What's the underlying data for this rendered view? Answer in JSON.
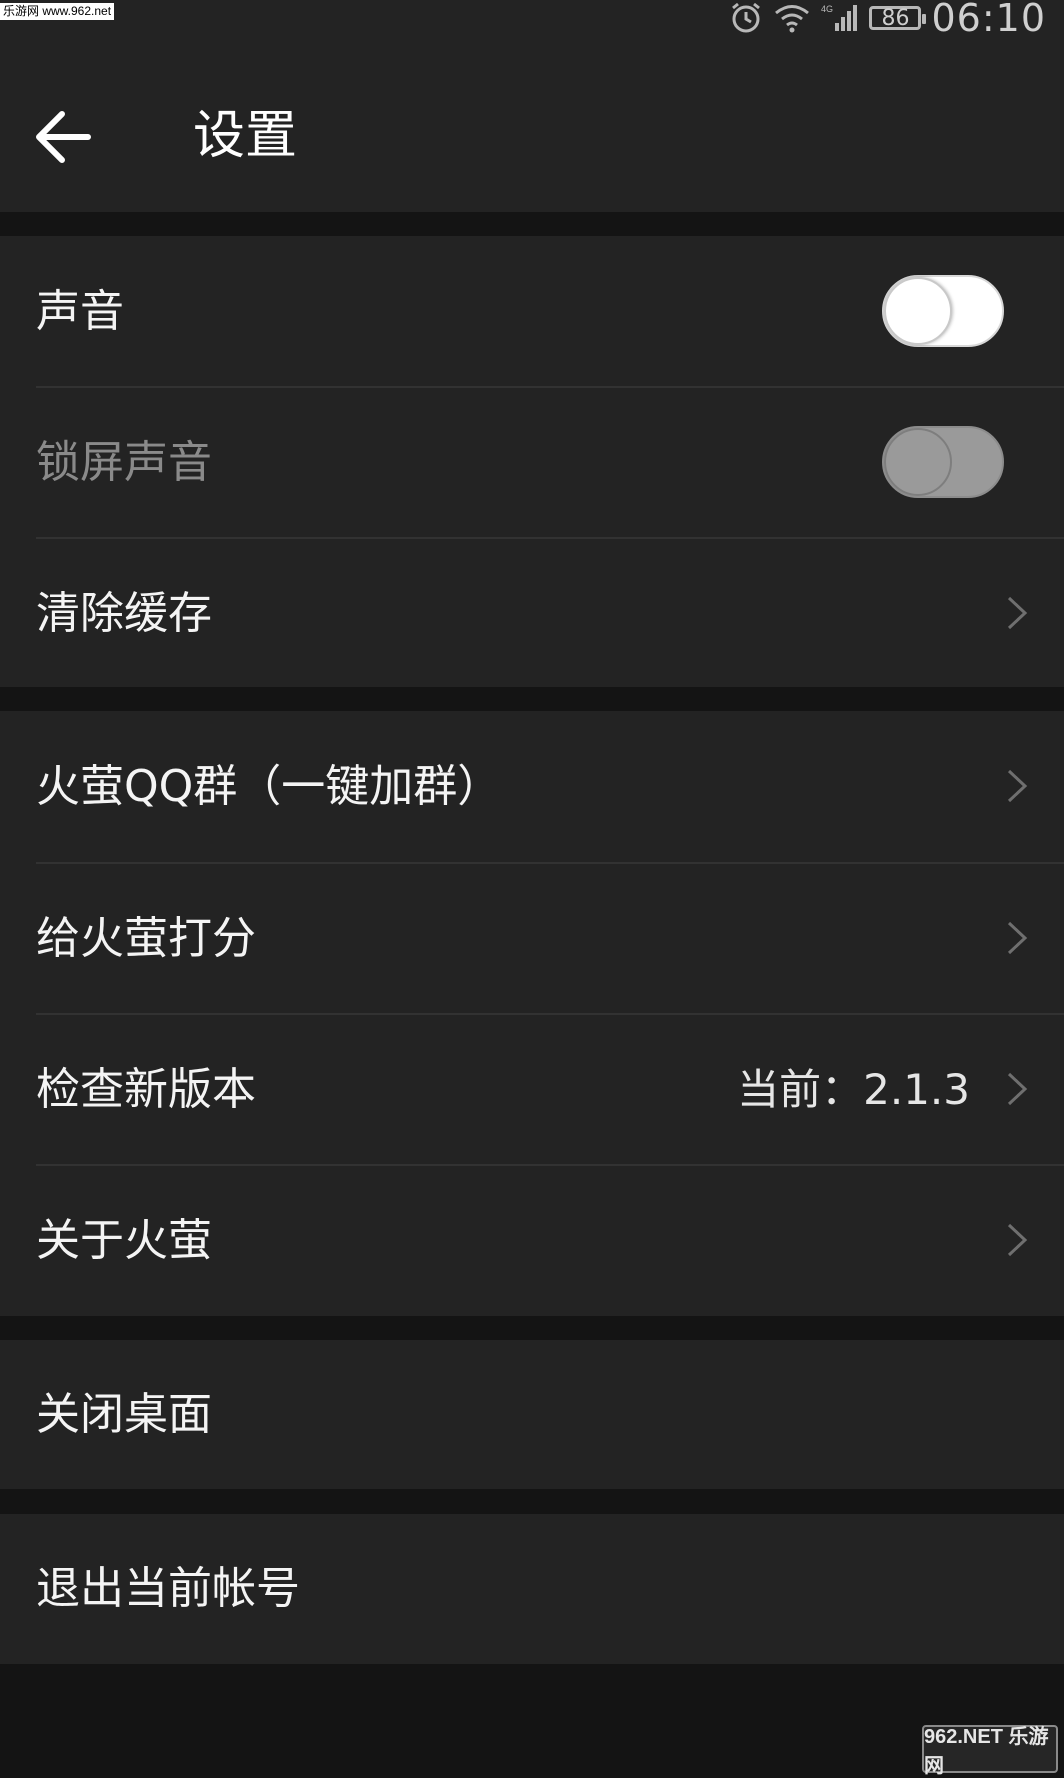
{
  "status_bar": {
    "left_badge": "乐游网 www.962.net",
    "battery": "86",
    "time": "06:10",
    "network": "4G"
  },
  "header": {
    "title": "设置"
  },
  "groups": [
    {
      "items": [
        {
          "label": "声音",
          "control": "toggle",
          "state": "off"
        },
        {
          "label": "锁屏声音",
          "control": "toggle",
          "state": "disabled"
        },
        {
          "label": "清除缓存",
          "control": "chevron"
        }
      ]
    },
    {
      "items": [
        {
          "label": "火萤QQ群（一键加群）",
          "control": "chevron"
        },
        {
          "label": "给火萤打分",
          "control": "chevron"
        },
        {
          "label": "检查新版本",
          "value": "当前：2.1.3",
          "control": "chevron"
        },
        {
          "label": "关于火萤",
          "control": "chevron"
        }
      ]
    },
    {
      "items": [
        {
          "label": "关闭桌面"
        }
      ]
    },
    {
      "items": [
        {
          "label": "退出当前帐号"
        }
      ]
    }
  ],
  "watermark": {
    "text": "962.NET 乐游网"
  },
  "colors": {
    "background": "#141414",
    "surface": "#232323",
    "divider": "#323232",
    "text": "#f4f4f4",
    "text_disabled": "#8a8a8a"
  }
}
